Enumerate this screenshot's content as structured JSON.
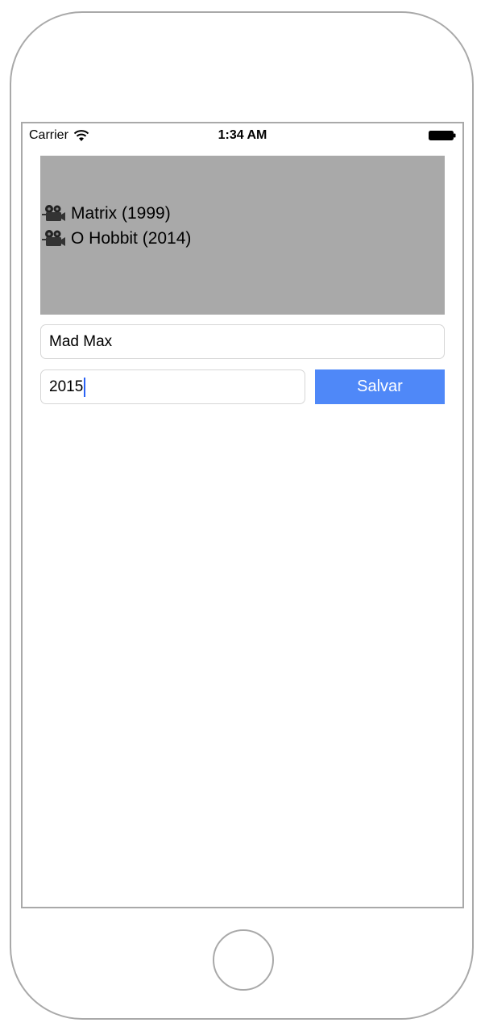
{
  "status_bar": {
    "carrier": "Carrier",
    "time": "1:34 AM",
    "wifi_icon": "wifi-icon",
    "battery_icon": "battery-icon"
  },
  "movies": {
    "items": [
      {
        "icon": "movie-camera-icon",
        "label": "Matrix (1999)"
      },
      {
        "icon": "movie-camera-icon",
        "label": "O Hobbit (2014)"
      }
    ],
    "background_color": "#a9a9a9"
  },
  "form": {
    "title_value": "Mad Max",
    "year_value": "2015",
    "save_label": "Salvar",
    "save_color": "#4f88f8"
  }
}
